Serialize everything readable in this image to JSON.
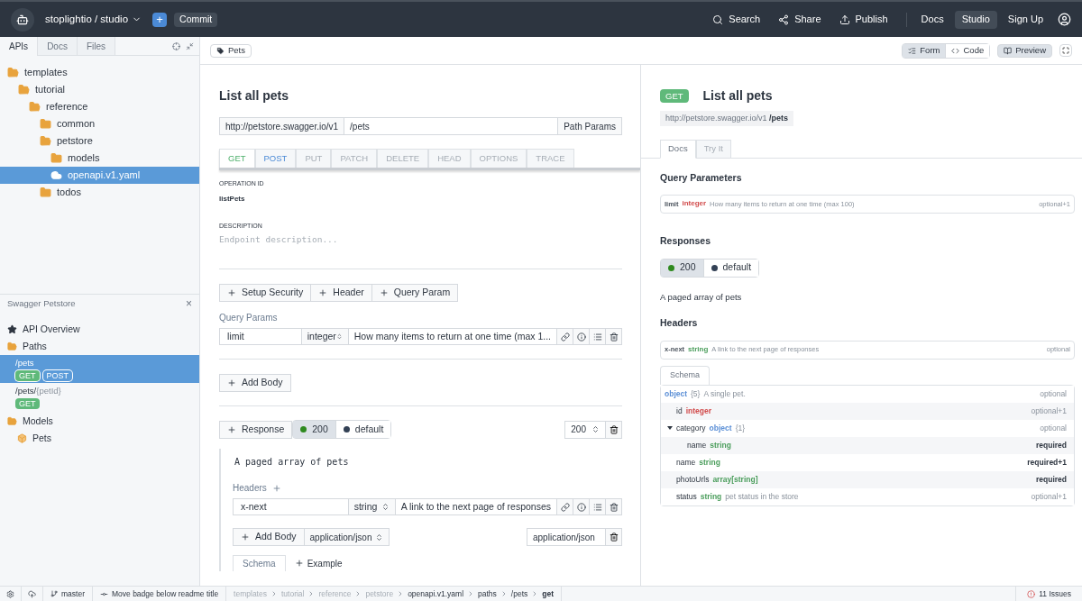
{
  "topbar": {
    "project": "stoplightio / studio",
    "add": "+",
    "commit": "Commit",
    "actions": [
      {
        "label": "Search",
        "kind": "search"
      },
      {
        "label": "Share",
        "kind": "share"
      },
      {
        "label": "Publish",
        "kind": "publish"
      }
    ],
    "links": [
      {
        "label": "Docs",
        "selected": false
      },
      {
        "label": "Studio",
        "selected": true
      },
      {
        "label": "Sign Up",
        "selected": false
      }
    ]
  },
  "sidebar": {
    "tabs": [
      {
        "label": "APIs",
        "selected": true
      },
      {
        "label": "Docs",
        "selected": false
      },
      {
        "label": "Files",
        "selected": false
      }
    ],
    "tree": [
      {
        "name": "templates",
        "expanded": true,
        "selected": false,
        "children": [
          {
            "name": "tutorial",
            "expanded": true,
            "selected": false,
            "children": [
              {
                "name": "reference",
                "expanded": true,
                "selected": false,
                "children": [
                  {
                    "name": "common",
                    "expanded": false,
                    "selected": false
                  },
                  {
                    "name": "petstore",
                    "expanded": true,
                    "selected": false,
                    "children": [
                      {
                        "name": "models",
                        "expanded": false,
                        "selected": false
                      },
                      {
                        "name": "openapi.v1.yaml",
                        "selected": true
                      }
                    ]
                  },
                  {
                    "name": "todos",
                    "expanded": false,
                    "selected": false
                  }
                ]
              }
            ]
          }
        ]
      }
    ]
  },
  "outline": {
    "title": "Swagger Petstore",
    "close": "×",
    "overview": "API Overview",
    "paths_label": "Paths",
    "paths": [
      {
        "path": "/pets",
        "selected": true,
        "methods": [
          {
            "label": "GET",
            "color": "#5fb97a"
          },
          {
            "label": "POST",
            "color": "#5b9bd9"
          }
        ]
      },
      {
        "path": "/pets/",
        "param": "{petId}",
        "selected": false,
        "methods": [
          {
            "label": "GET",
            "color": "#5fb97a"
          }
        ]
      }
    ],
    "models_label": "Models",
    "models": [
      {
        "label": "Pets"
      }
    ]
  },
  "editor": {
    "tag": "Pets",
    "title": "List all pets",
    "server": "http://petstore.swagger.io/v1",
    "path": "/pets",
    "path_params": "Path Params",
    "methods": [
      {
        "label": "GET",
        "selected": true,
        "defined": true
      },
      {
        "label": "POST",
        "selected": false,
        "defined": true
      },
      {
        "label": "PUT",
        "selected": false,
        "defined": false
      },
      {
        "label": "PATCH",
        "selected": false,
        "defined": false
      },
      {
        "label": "DELETE",
        "selected": false,
        "defined": false
      },
      {
        "label": "HEAD",
        "selected": false,
        "defined": false
      },
      {
        "label": "OPTIONS",
        "selected": false,
        "defined": false
      },
      {
        "label": "TRACE",
        "selected": false,
        "defined": false
      }
    ],
    "operation_id_label": "OPERATION ID",
    "operation_id": "listPets",
    "description_label": "DESCRIPTION",
    "description_placeholder": "Endpoint description...",
    "add_buttons": [
      "Setup Security",
      "Header",
      "Query Param"
    ],
    "query_params_label": "Query Params",
    "query_params": [
      {
        "name": "limit",
        "type": "integer",
        "description": "How many items to return at one time (max 1..."
      }
    ],
    "add_body": "Add Body",
    "response_button": "Response",
    "responses": [
      {
        "label": "200",
        "color": "#2f8a1f",
        "selected": true
      },
      {
        "label": "default",
        "color": "#334155",
        "selected": false
      }
    ],
    "status_code": "200",
    "response_description": "A paged array of pets",
    "headers_label": "Headers",
    "headers": [
      {
        "name": "x-next",
        "type": "string",
        "description": "A link to the next page of responses"
      }
    ],
    "body_add": "Add Body",
    "body_type": "application/json",
    "body_field": "application/json",
    "body_tabs": [
      {
        "label": "Schema",
        "selected": true
      },
      {
        "label": "Example",
        "selected": false
      }
    ]
  },
  "view_toggle": [
    {
      "label": "Form",
      "kind": "form",
      "selected": true
    },
    {
      "label": "Code",
      "kind": "code",
      "selected": false
    }
  ],
  "preview_button": {
    "label": "Preview",
    "selected": true
  },
  "preview": {
    "method": "GET",
    "title": "List all pets",
    "server": "http://petstore.swagger.io/v1",
    "path": "/pets",
    "tabs": [
      {
        "label": "Docs",
        "selected": true
      },
      {
        "label": "Try It",
        "selected": false
      }
    ],
    "query_heading": "Query Parameters",
    "query_params": [
      {
        "name": "limit",
        "type": "integer",
        "color": "#d14a4a",
        "description": "How many items to return at one time (max 100)",
        "requirement": "optional+1",
        "required": false
      }
    ],
    "responses_heading": "Responses",
    "responses": [
      {
        "label": "200",
        "color": "#2f8a1f",
        "selected": true
      },
      {
        "label": "default",
        "color": "#334155",
        "selected": false
      }
    ],
    "response_description": "A paged array of pets",
    "headers_heading": "Headers",
    "headers": [
      {
        "name": "x-next",
        "type": "string",
        "color": "#4a9d5b",
        "description": "A link to the next page of responses",
        "requirement": "optional",
        "required": false
      }
    ],
    "schema_tab": "Schema",
    "schema": {
      "type": "object",
      "color": "#5b8fd6",
      "count": "{5}",
      "description": "A single pet.",
      "requirement": "optional",
      "required": false,
      "children": [
        {
          "name": "id",
          "type": "integer",
          "color": "#d14a4a",
          "requirement": "optional+1",
          "required": false
        },
        {
          "name": "category",
          "type": "object",
          "color": "#5b8fd6",
          "count": "{1}",
          "requirement": "optional",
          "required": false,
          "expanded": true,
          "children": [
            {
              "name": "name",
              "type": "string",
              "color": "#4a9d5b",
              "requirement": "required",
              "required": true
            }
          ]
        },
        {
          "name": "name",
          "type": "string",
          "color": "#4a9d5b",
          "requirement": "required+1",
          "required": true
        },
        {
          "name": "photoUrls",
          "type": "array[string]",
          "color": "#4a9d5b",
          "requirement": "required",
          "required": true
        },
        {
          "name": "status",
          "type": "string",
          "color": "#4a9d5b",
          "description": "pet status in the store",
          "requirement": "optional+1",
          "required": false
        }
      ]
    }
  },
  "status_bar": {
    "branch": "master",
    "commit": "Move badge below readme title",
    "breadcrumbs": [
      {
        "label": "templates",
        "dimmed": true,
        "selected": false
      },
      {
        "label": "tutorial",
        "dimmed": true,
        "selected": false
      },
      {
        "label": "reference",
        "dimmed": true,
        "selected": false
      },
      {
        "label": "petstore",
        "dimmed": true,
        "selected": false
      },
      {
        "label": "openapi.v1.yaml",
        "dimmed": false,
        "selected": false
      },
      {
        "label": "paths",
        "dimmed": false,
        "selected": false
      },
      {
        "label": "/pets",
        "dimmed": false,
        "selected": false
      },
      {
        "label": "get",
        "dimmed": false,
        "selected": true
      }
    ],
    "issues": "11 Issues"
  }
}
